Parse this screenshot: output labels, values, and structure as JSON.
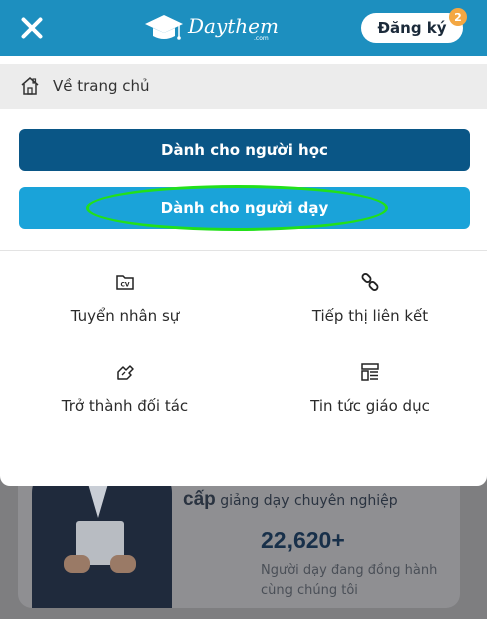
{
  "header": {
    "logo_text": "Daythem",
    "logo_domain": ".com",
    "register_label": "Đăng ký",
    "notification_count": "2"
  },
  "menu": {
    "home_label": "Về trang chủ",
    "learner_button": "Dành cho người học",
    "teacher_button": "Dành cho người dạy",
    "grid": [
      {
        "label": "Tuyển nhân sự",
        "icon": "cv-folder-icon"
      },
      {
        "label": "Tiếp thị liên kết",
        "icon": "link-icon"
      },
      {
        "label": "Trở thành đối tác",
        "icon": "handshake-icon"
      },
      {
        "label": "Tin tức giáo dục",
        "icon": "news-layout-icon"
      }
    ]
  },
  "background": {
    "title_strong": "cấp",
    "title_rest": " giảng dạy chuyên nghiệp",
    "stat_number": "22,620+",
    "stat_label": "Người dạy đang đồng hành cùng chúng tôi"
  },
  "colors": {
    "header_bg": "#1d8fbf",
    "learner_button": "#0a5686",
    "teacher_button": "#1aa3d9",
    "highlight": "#22e01a",
    "badge": "#f4a742"
  }
}
